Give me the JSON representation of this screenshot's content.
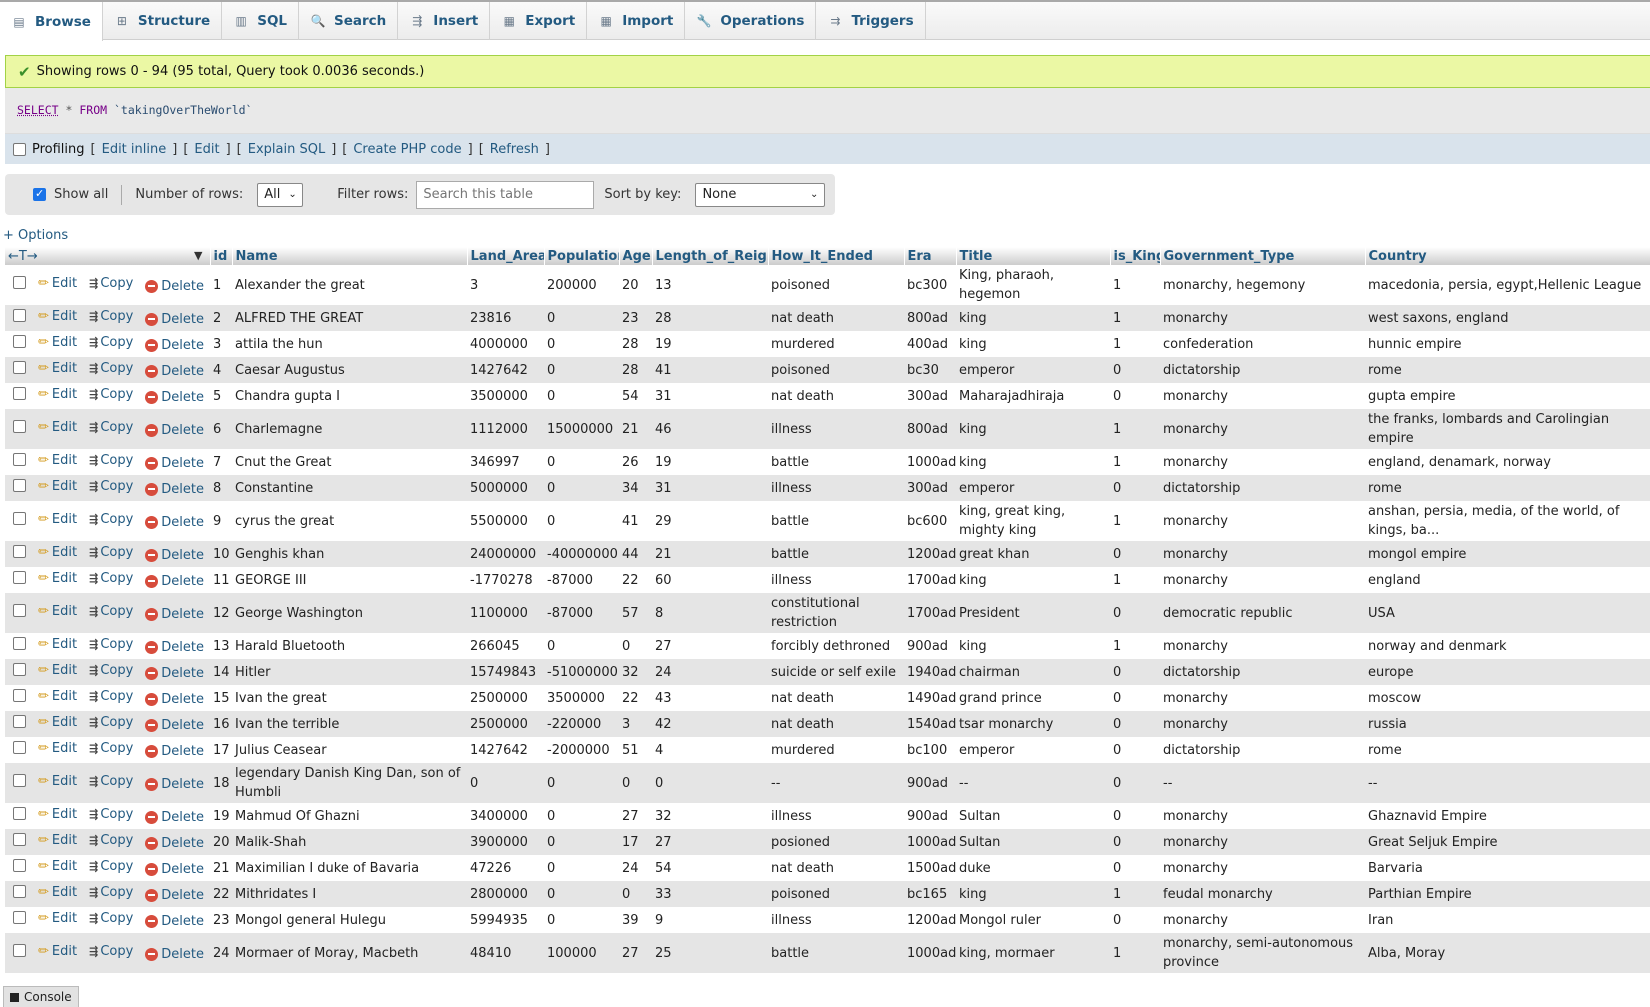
{
  "tabs": [
    {
      "label": "Browse",
      "icon": "browse-icon",
      "glyph": "▤",
      "active": true
    },
    {
      "label": "Structure",
      "icon": "structure-icon",
      "glyph": "⊞",
      "active": false
    },
    {
      "label": "SQL",
      "icon": "sql-icon",
      "glyph": "▥",
      "active": false
    },
    {
      "label": "Search",
      "icon": "search-icon",
      "glyph": "🔍",
      "active": false
    },
    {
      "label": "Insert",
      "icon": "insert-icon",
      "glyph": "⇶",
      "active": false
    },
    {
      "label": "Export",
      "icon": "export-icon",
      "glyph": "▦",
      "active": false
    },
    {
      "label": "Import",
      "icon": "import-icon",
      "glyph": "▦",
      "active": false
    },
    {
      "label": "Operations",
      "icon": "wrench-icon",
      "glyph": "🔧",
      "active": false
    },
    {
      "label": "Triggers",
      "icon": "triggers-icon",
      "glyph": "⇉",
      "active": false
    }
  ],
  "success_message": "Showing rows 0 - 94 (95 total, Query took 0.0036 seconds.)",
  "sql": {
    "select": "SELECT",
    "star": "*",
    "from": "FROM",
    "table": "`takingOverTheWorld`"
  },
  "profiling": {
    "label": "Profiling",
    "links": [
      "Edit inline",
      "Edit",
      "Explain SQL",
      "Create PHP code",
      "Refresh"
    ]
  },
  "nav": {
    "show_all": "Show all",
    "number_of_rows": "Number of rows:",
    "rows_value": "All",
    "filter_rows": "Filter rows:",
    "filter_placeholder": "Search this table",
    "sort_by_key": "Sort by key:",
    "sort_value": "None"
  },
  "options_link": "+ Options",
  "header_arrows": "←T→",
  "columns": [
    "id",
    "Name",
    "Land_Area",
    "Population",
    "Age",
    "Length_of_Reign",
    "How_It_Ended",
    "Era",
    "Title",
    "is_King",
    "Government_Type",
    "Country"
  ],
  "actions": {
    "edit": "Edit",
    "copy": "Copy",
    "delete": "Delete"
  },
  "rows": [
    [
      "1",
      "Alexander the great",
      "3",
      "200000",
      "20",
      "13",
      "poisoned",
      "bc300",
      " King, pharaoh, hegemon",
      "1",
      "monarchy, hegemony",
      "macedonia, persia, egypt,Hellenic League"
    ],
    [
      "2",
      "ALFRED THE GREAT",
      "23816",
      "0",
      "23",
      "28",
      "nat death",
      "800ad",
      "king",
      "1",
      "monarchy",
      "west saxons, england"
    ],
    [
      "3",
      "attila the hun",
      "4000000",
      "0",
      "28",
      "19",
      "murdered",
      "400ad",
      "king",
      "1",
      "confederation",
      "hunnic empire"
    ],
    [
      "4",
      "Caesar Augustus",
      "1427642",
      "0",
      "28",
      "41",
      "poisoned",
      "bc30",
      "emperor",
      "0",
      "dictatorship",
      "rome"
    ],
    [
      "5",
      "Chandra gupta I",
      "3500000",
      "0",
      "54",
      "31",
      "nat death",
      "300ad",
      "Maharajadhiraja",
      "0",
      "monarchy",
      "gupta empire"
    ],
    [
      "6",
      "Charlemagne",
      "1112000",
      "15000000",
      "21",
      "46",
      "illness",
      "800ad",
      "king",
      "1",
      "monarchy",
      "the franks, lombards and Carolingian empire"
    ],
    [
      "7",
      "Cnut the Great",
      "346997",
      "0",
      "26",
      "19",
      "battle",
      "1000ad",
      "king",
      "1",
      "monarchy",
      "england, denamark, norway"
    ],
    [
      "8",
      "Constantine",
      "5000000",
      "0",
      "34",
      "31",
      "illness",
      "300ad",
      " emperor",
      "0",
      "dictatorship",
      "rome"
    ],
    [
      "9",
      "cyrus the great",
      "5500000",
      "0",
      "41",
      "29",
      "battle",
      "bc600",
      "king, great king, mighty king",
      "1",
      "monarchy",
      "anshan, persia, media, of the world, of kings,  ba..."
    ],
    [
      "10",
      "Genghis khan",
      "24000000",
      "-40000000",
      "44",
      "21",
      "battle",
      "1200ad",
      "great khan",
      "0",
      "monarchy",
      "mongol empire"
    ],
    [
      "11",
      "GEORGE III",
      "-1770278",
      "-87000",
      "22",
      "60",
      "illness",
      "1700ad",
      "king",
      "1",
      "monarchy",
      "england"
    ],
    [
      "12",
      "George Washington",
      "1100000",
      "-87000",
      "57",
      "8",
      "constitutional restriction",
      "1700ad",
      "President",
      "0",
      "democratic republic",
      "USA"
    ],
    [
      "13",
      "Harald Bluetooth",
      "266045",
      "0",
      "0",
      "27",
      "forcibly dethroned",
      "900ad",
      "king",
      "1",
      "monarchy",
      "norway and denmark"
    ],
    [
      "14",
      "Hitler",
      "15749843",
      "-51000000",
      "32",
      "24",
      "suicide or self exile",
      "1940ad",
      "chairman",
      "0",
      "dictatorship",
      "europe"
    ],
    [
      "15",
      "Ivan the great",
      "2500000",
      "3500000",
      "22",
      "43",
      "nat death",
      "1490ad",
      "grand prince",
      "0",
      "monarchy",
      "moscow"
    ],
    [
      "16",
      "Ivan the terrible",
      "2500000",
      "-220000",
      "3",
      "42",
      "nat death",
      "1540ad",
      "tsar monarchy",
      "0",
      "monarchy",
      "russia"
    ],
    [
      "17",
      "Julius Ceasear",
      "1427642",
      "-2000000",
      "51",
      "4",
      "murdered",
      "bc100",
      "emperor",
      "0",
      "dictatorship",
      "rome"
    ],
    [
      "18",
      "legendary Danish King Dan, son of Humbli",
      "0",
      "0",
      "0",
      "0",
      "--",
      "900ad",
      "--",
      "0",
      "--",
      "--"
    ],
    [
      "19",
      "Mahmud Of Ghazni",
      "3400000",
      "0",
      "27",
      "32",
      "illness",
      "900ad",
      "Sultan",
      "0",
      "monarchy",
      "Ghaznavid Empire"
    ],
    [
      "20",
      "Malik-Shah",
      "3900000",
      "0",
      "17",
      "27",
      "posioned",
      "1000ad",
      "Sultan",
      "0",
      "monarchy",
      "Great Seljuk Empire"
    ],
    [
      "21",
      "Maximilian I duke of Bavaria",
      "47226",
      "0",
      "24",
      "54",
      "nat death",
      "1500ad",
      "duke",
      "0",
      "monarchy",
      "Barvaria"
    ],
    [
      "22",
      "Mithridates I",
      "2800000",
      "0",
      "0",
      "33",
      "poisoned",
      "bc165",
      "king",
      "1",
      "feudal monarchy",
      "Parthian Empire"
    ],
    [
      "23",
      "Mongol general Hulegu",
      "5994935",
      "0",
      "39",
      "9",
      "illness",
      "1200ad",
      "Mongol ruler",
      "0",
      "monarchy",
      "Iran"
    ],
    [
      "24",
      "Mormaer of Moray, Macbeth",
      "48410",
      "100000",
      "27",
      "25",
      "battle",
      "1000ad",
      "king, mormaer",
      "1",
      "monarchy, semi-autonomous province",
      "Alba, Moray"
    ]
  ],
  "console": "Console"
}
